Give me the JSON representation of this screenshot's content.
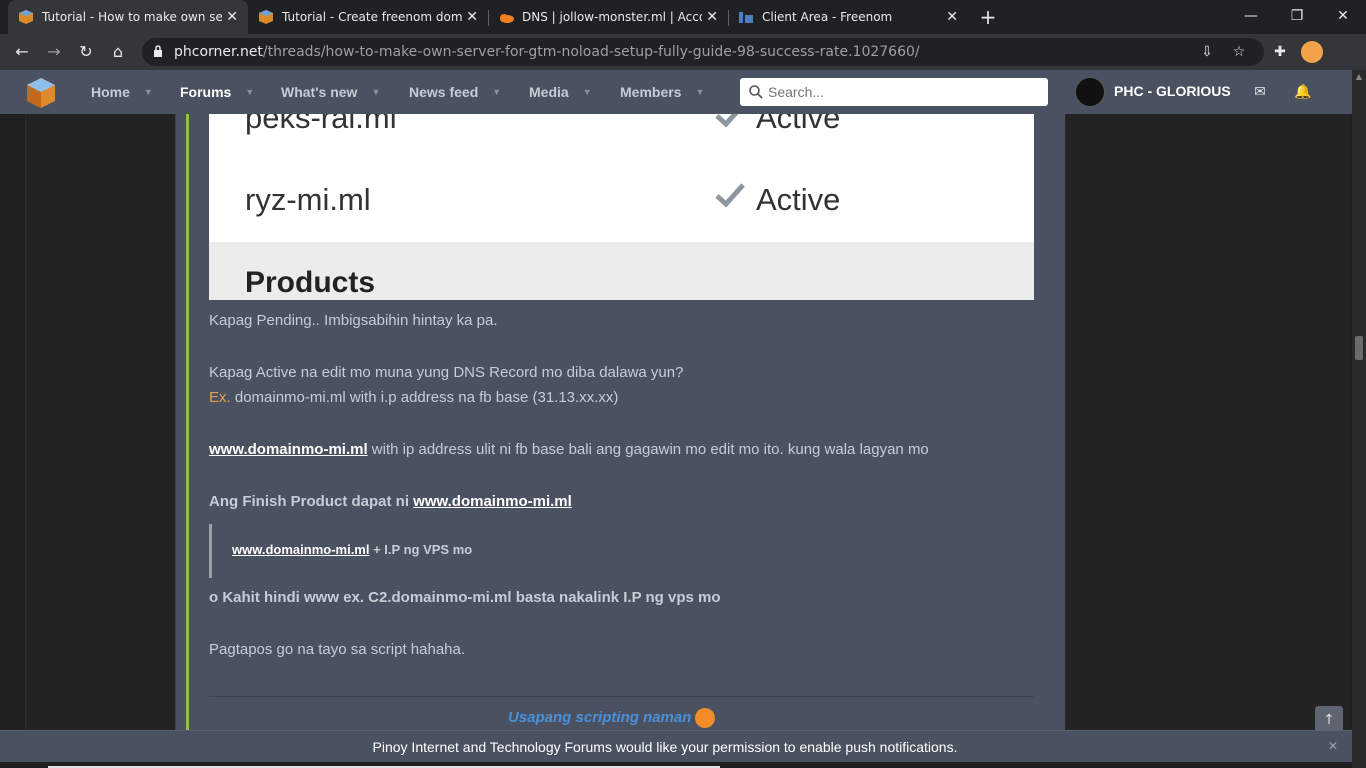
{
  "browser": {
    "tabs": [
      {
        "title": "Tutorial - How to make own serv",
        "active": true
      },
      {
        "title": "Tutorial - Create freenom domain",
        "active": false
      },
      {
        "title": "DNS | jollow-monster.ml | Accou",
        "active": false
      },
      {
        "title": "Client Area - Freenom",
        "active": false
      }
    ],
    "url_host": "phcorner.net",
    "url_path": "/threads/how-to-make-own-server-for-gtm-noload-setup-fully-guide-98-success-rate.1027660/",
    "glyphs": {
      "close": "✕",
      "new_tab": "+",
      "minimize": "—",
      "maximize": "❐",
      "window_close": "✕",
      "back": "←",
      "forward": "→",
      "reload": "↻",
      "home": "⌂",
      "install": "⇩",
      "bookmark": "☆",
      "extensions": "✚"
    }
  },
  "site": {
    "nav": [
      {
        "label": "Home",
        "selected": false
      },
      {
        "label": "Forums",
        "selected": true
      },
      {
        "label": "What's new",
        "selected": false
      },
      {
        "label": "News feed",
        "selected": false
      },
      {
        "label": "Media",
        "selected": false
      },
      {
        "label": "Members",
        "selected": false
      }
    ],
    "caret": "▼",
    "search_placeholder": "Search...",
    "username": "PHC - GLORIOUS",
    "inbox_glyph": "✉",
    "alerts_glyph": "🔔"
  },
  "post": {
    "screenshot": {
      "rows": [
        {
          "domain": "peks-rai.ml",
          "status": "Active"
        },
        {
          "domain": "ryz-mi.ml",
          "status": "Active"
        }
      ],
      "section_title": "Products"
    },
    "line_pending": "Kapag Pending.. Imbigsabihin hintay ka pa.",
    "line_active": "Kapag Active na edit mo muna yung DNS Record mo diba dalawa yun?",
    "ex_label": "Ex.",
    "line_ex": " domainmo-mi.ml with i.p address na fb base (31.13.xx.xx)",
    "www_link": "www.domainmo-mi.ml",
    "line_www": " with ip address ulit ni fb base bali ang gagawin mo edit mo ito. kung wala lagyan mo",
    "finish_prefix": "Ang Finish Product dapat ni ",
    "finish_link": "www.domainmo-mi.ml",
    "quote_link": "www.domainmo-mi.ml",
    "quote_text": " + I.P ng VPS mo",
    "line_or": "o Kahit hindi www ex. C2.domainmo-mi.ml basta nakalink I.P ng vps mo",
    "line_end": "Pagtapos go na tayo sa script hahaha.",
    "signature": "Usapang scripting naman"
  },
  "scroll_top_glyph": "↑",
  "notification": {
    "text": "Pinoy Internet and Technology Forums would like your permission to enable push notifications.",
    "close": "✕"
  },
  "colors": {
    "nav_bg": "#4a5160",
    "post_bg": "#4a5160",
    "accent_bar": "#8cc43a",
    "link_blue": "#4a90d9"
  }
}
